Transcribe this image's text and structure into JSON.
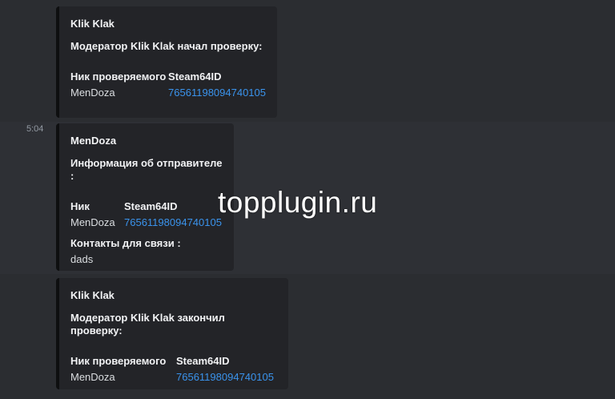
{
  "messages": [
    {
      "timestamp": "",
      "author": "Klik Klak",
      "title": "Модератор Klik Klak начал проверку:",
      "fields": [
        {
          "name": "Ник проверяемого",
          "value": "MenDoza"
        },
        {
          "name": "Steam64ID",
          "value": "76561198094740105"
        }
      ]
    },
    {
      "timestamp": "5:04",
      "author": "MenDoza",
      "title": "Информация об отправителе :",
      "fields": [
        {
          "name": "Ник",
          "value": "MenDoza"
        },
        {
          "name": "Steam64ID",
          "value": "76561198094740105"
        }
      ],
      "extra_field": {
        "name": "Контакты для связи :",
        "value": "dads"
      }
    },
    {
      "timestamp": "",
      "author": "Klik Klak",
      "title": "Модератор Klik Klak закончил проверку:",
      "fields": [
        {
          "name": "Ник проверяемого",
          "value": "MenDoza"
        },
        {
          "name": "Steam64ID",
          "value": "76561198094740105"
        }
      ]
    }
  ],
  "watermark": "topplugin.ru",
  "colors": {
    "background": "#2b2d31",
    "embed_background": "#232428",
    "link": "#3a93ec",
    "embed_border": "#0e0f10"
  }
}
